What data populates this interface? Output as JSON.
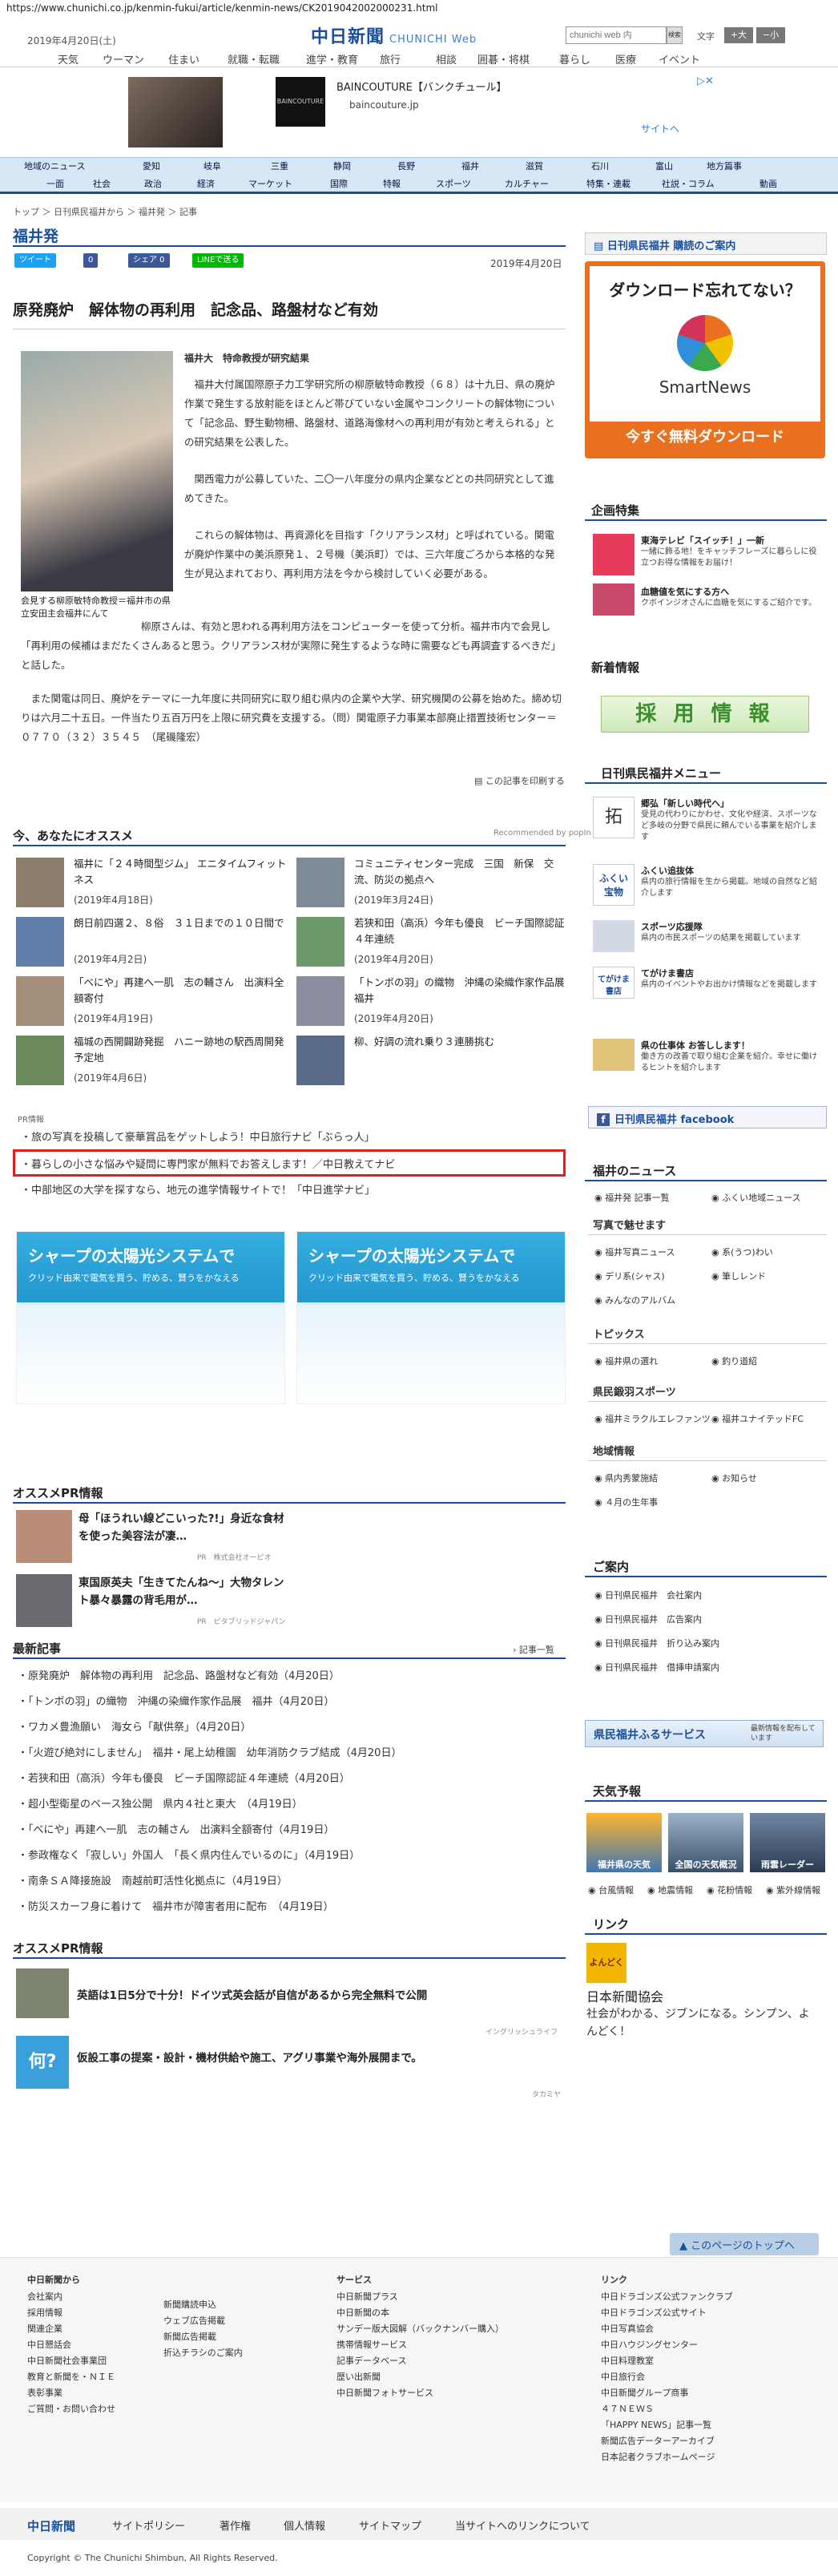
{
  "url": "https://www.chunichi.co.jp/kenmin-fukui/article/kenmin-news/CK2019042002000231.html",
  "header": {
    "date": "2019年4月20日(土)",
    "logo": "中日新聞",
    "logo_sub": "CHUNICHI Web",
    "search_placeholder": "chunichi web 内",
    "search_btn": "検索",
    "font_label": "文字",
    "font_big": "+大",
    "font_small": "−小"
  },
  "topnav": [
    "天気",
    "ウーマン",
    "住まい",
    "就職・転職",
    "進学・教育",
    "旅行",
    "相談",
    "囲碁・将棋",
    "暮らし",
    "医療",
    "イベント"
  ],
  "ad": {
    "label": "広告",
    "brand": "BAINCOUTURE",
    "title": "BAINCOUTURE【バンクチュール】",
    "site": "baincouture.jp",
    "link": "サイトへ"
  },
  "nav2_row1": [
    "地域のニュース",
    "愛知",
    "岐阜",
    "三重",
    "静岡",
    "長野",
    "福井",
    "滋賀",
    "石川",
    "富山",
    "地方篇事"
  ],
  "nav2_row2": [
    "一面",
    "社会",
    "政治",
    "経済",
    "マーケット",
    "国際",
    "特報",
    "スポーツ",
    "カルチャー",
    "特集・連載",
    "社説・コラム",
    "動画"
  ],
  "breadcrumb": "トップ ＞ 日刊県民福井から ＞ 福井発 ＞ 記事",
  "page_title": "福井発",
  "share": {
    "tweet": "ツイート",
    "fb": "0",
    "share": "シェア 0",
    "line": "LINEで送る"
  },
  "article": {
    "date": "2019年4月20日",
    "headline": "原発廃炉　解体物の再利用　記念品、路盤材など有効",
    "author": "福井大　特命教授が研究結果",
    "caption": "会見する柳原敏特命教授＝福井市の県立安田主会福井にんて",
    "p1": "福井大付属国際原子力工学研究所の柳原敏特命教授（６８）は十九日、県の廃炉作業で発生する放射能をほとんど帯びていない金属やコンクリートの解体物について「記念品、野生動物柵、路盤材、道路海像材への再利用が有効と考えられる」との研究結果を公表した。",
    "p2": "関西電力が公募していた、二〇一八年度分の県内企業などとの共同研究として進めてきた。",
    "p3": "これらの解体物は、再資源化を目指す「クリアランス材」と呼ばれている。関電が廃炉作業中の美浜原発１、２号機（美浜町）では、三六年度ごろから本格的な発生が見込まれており、再利用方法を今から検討していく必要がある。",
    "p4": "柳原さんは、有効と思われる再利用方法をコンピューターを使って分析。福井市内で会見し「再利用の候補はまだたくさんあると思う。クリアランス材が実際に発生するような時に需要なども再調査するべきだ」と話した。",
    "p5": "また関電は同日、廃炉をテーマに一九年度に共同研究に取り組む県内の企業や大学、研究機関の公募を始めた。締め切りは六月二十五日。一件当たり五百万円を上限に研究費を支援する。（問）関電原子力事業本部廃止措置技術センター＝０７７０（３２）３５４５　（尾磯隆宏）",
    "print": "この記事を印刷する"
  },
  "recommend": {
    "title": "今、あなたにオススメ",
    "provider": "Recommended by popIn",
    "items": [
      {
        "title": "福井に「２４時間型ジム」 エニタイムフィットネス",
        "date": "(2019年4月18日)"
      },
      {
        "title": "コミュニティセンター完成　三国　新保　交流、防災の拠点へ",
        "date": "(2019年3月24日)"
      },
      {
        "title": "朗日前四選２、８俗　３１日までの１０日間で",
        "date": "(2019年4月2日)"
      },
      {
        "title": "若狭和田（高浜）今年も優良　ビーチ国際認証４年連続",
        "date": "(2019年4月20日)"
      },
      {
        "title": "「べにや」再建へ一肌　志の輔さん　出演料全額寄付",
        "date": "(2019年4月19日)"
      },
      {
        "title": "「トンボの羽」の織物　沖縄の染織作家作品展　福井",
        "date": "(2019年4月20日)"
      },
      {
        "title": "福城の西開闢跡発掘　ハニー跡地の駅西周開発予定地",
        "date": "(2019年4月6日)"
      },
      {
        "title": "柳、好調の流れ乗り３連勝挑む",
        "date": ""
      }
    ]
  },
  "pr": {
    "label": "PR情報",
    "items": [
      "旅の写真を投稿して豪華賞品をゲットしよう！中日旅行ナビ「ぶらっ人」",
      "暮らしの小さな悩みや疑問に専門家が無料でお答えします！／中日教えてナビ",
      "中部地区の大学を探すなら、地元の進学情報サイトで！「中日進学ナビ」"
    ]
  },
  "sharp": {
    "title1": "シャープの太陽光システムで",
    "title2": "クリッド由来で電気を買う、貯める、賢うをかなえる"
  },
  "opr1": {
    "title": "オススメPR情報",
    "items": [
      {
        "title": "母「ほうれい線どこいった?!」身近な食材を使った美容法が凄…",
        "src": "PR　株式会社オーピオ"
      },
      {
        "title": "東国原英夫「生きてたんね～」大物タレント暴々暴露の背毛用が…",
        "src": "PR　ビタブリッドジャパン"
      }
    ]
  },
  "latest": {
    "title": "最新記事",
    "more": "記事一覧",
    "items": [
      "原発廃炉　解体物の再利用　記念品、路盤材など有効（4月20日）",
      "「トンボの羽」の織物　沖縄の染織作家作品展　福井（4月20日）",
      "ワカメ豊漁願い　海女ら「献供祭」（4月20日）",
      "「火遊び絶対にしません」　福井・尾上幼稚園　幼年消防クラブ結成（4月20日）",
      "若狭和田（高浜）今年も優良　ビーチ国際認証４年連続（4月20日）",
      "超小型衛星のベース独公開　県内４社と東大　（4月19日）",
      "「べにや」再建へ一肌　志の輔さん　出演料全額寄付（4月19日）",
      "参政権なく「寂しい」外国人　「長く県内住んでいるのに」（4月19日）",
      "南条ＳＡ降接施設　南越前町活性化拠点に（4月19日）",
      "防災スカーフ身に着けて　福井市が障害者用に配布　（4月19日）"
    ]
  },
  "opr2": {
    "title": "オススメPR情報",
    "items": [
      {
        "title": "英語は1日5分で十分！ドイツ式英会話が自信があるから完全無料で公開",
        "src": "イングリッシュライフ"
      },
      {
        "title": "仮設工事の提案・設計・機材供給や施工、アグリ事業や海外展開まで。",
        "src": "タカミヤ",
        "icon": "何?"
      }
    ]
  },
  "side": {
    "banner_subscribe": "日刊県民福井 購読のご案内",
    "sn_title": "ダウンロード忘れてない？",
    "sn_name": "SmartNews",
    "sn_btn": "今すぐ無料ダウンロード",
    "kikaku": "企画特集",
    "kikaku_items": [
      {
        "title": "東海テレビ「スイッチ！」一新",
        "desc": "一緒に飾る地！をキャッチフレーズに暮らしに役立つお得な情報をお届け！"
      },
      {
        "title": "血糖値を気にする方へ",
        "desc": "クボインジオさんに血糖を気にするご紹介です。"
      }
    ],
    "shinsotsu": "新着情報",
    "recruit": "採 用 情 報",
    "menu": "日刊県民福井メニュー",
    "menu_items": [
      {
        "title": "郷弘「新しい時代へ」",
        "desc": "受見の代わりにかわせ、文化や経済、スポーツなど多岐の分野で県民に頼んでいる事業を紹介します"
      },
      {
        "title": "ふくい追抜体",
        "desc": "県内の旅行情報を生から掲載。地域の自然など紹介します"
      },
      {
        "title": "スポーツ応援隊",
        "desc": "県内の市民スポーツの結果を掲載しています"
      },
      {
        "title": "てがけま書店",
        "desc": "県内のイベントやお出かけ情報などを掲載します"
      },
      {
        "title": "県の仕事体 お答しします！",
        "desc": "働き方の改善で取り組む企業を紹介。幸せに働けるヒントを紹介します"
      }
    ],
    "facebook": "日刊県民福井 facebook",
    "fukui_news": "福井のニュース",
    "fn_items": [
      "福井発 記事一覧",
      "ふくい地域ニュース"
    ],
    "photo_head": "写真で魅せます",
    "photo_items": [
      "福井写真ニュース",
      "系(うつ)わい",
      "デリ系(シャス)",
      "筆しレンド",
      "みんなのアルバム"
    ],
    "topics": "トピックス",
    "topics_items": [
      "福井県の選れ",
      "釣り道紹"
    ],
    "sports": "県民鍛羽スポーツ",
    "sports_items": [
      "福井ミラクルエレファンツ",
      "福井ユナイテッドFC"
    ],
    "chiiki": "地域情報",
    "chiiki_items": [
      "県内秀蒙施結",
      "お知らせ"
    ],
    "chiiki_extra": "４月の生年事",
    "annai": "ご案内",
    "annai_items": [
      "日刊県民福井　会社案内",
      "日刊県民福井　広告案内",
      "日刊県民福井　折り込み案内",
      "日刊県民福井　借挿申請案内"
    ],
    "furusato": "県民福井ふるサービス",
    "furusato_sub": "最新情報を配布しています",
    "tenki": "天気予報",
    "tenki_items": [
      "福井県の天気",
      "全国の天気概況",
      "雨雲レーダー"
    ],
    "warn_items": [
      "台風情報",
      "地震情報",
      "花粉情報",
      "紫外線情報"
    ],
    "link": "リンク",
    "link_title": "日本新聞協会",
    "link_desc": "社会がわかる、ジブンになる。シンプン、よんどく！"
  },
  "pagetop": "このページのトップへ",
  "footer": {
    "col1_head": "中日新聞から",
    "col1": [
      "会社案内",
      "採用情報",
      "関連企業",
      "中日懇話会",
      "中日新聞社会事業団",
      "教育と新聞を・ＮＩＥ",
      "表彰事業",
      "ご質問・お問い合わせ"
    ],
    "col2": [
      "新聞購読申込",
      "ウェブ広告掲載",
      "新聞広告掲載",
      "折込チラシのご案内"
    ],
    "col3_head": "サービス",
    "col3": [
      "中日新聞プラス",
      "中日新聞の本",
      "サンデー版大図解（バックナンバー購入）",
      "携帯情報サービス",
      "記事データベース",
      "歴い出新聞",
      "中日新聞フォトサービス"
    ],
    "col4_head": "リンク",
    "col4": [
      "中日ドラゴンズ公式ファンクラブ",
      "中日ドラゴンズ公式サイト",
      "中日写真協会",
      "中日ハウジングセンター",
      "中日料理教室",
      "中日旅行会",
      "中日新聞グループ商事",
      "４７ＮＥＷＳ",
      "「HAPPY NEWS」記事一覧",
      "新聞広告データーアーカイブ",
      "日本記者クラブホームページ"
    ],
    "bar": [
      "中日新聞",
      "サイトポリシー",
      "著作権",
      "個人情報",
      "サイトマップ",
      "当サイトへのリンクについて"
    ],
    "copyright": "Copyright © The Chunichi Shimbun, All Rights Reserved."
  },
  "colors": {
    "accent": "#1a4f9c",
    "red": "#e51d1d",
    "smartnews_orange": "#e8701e",
    "sharp": "#2396cf"
  }
}
